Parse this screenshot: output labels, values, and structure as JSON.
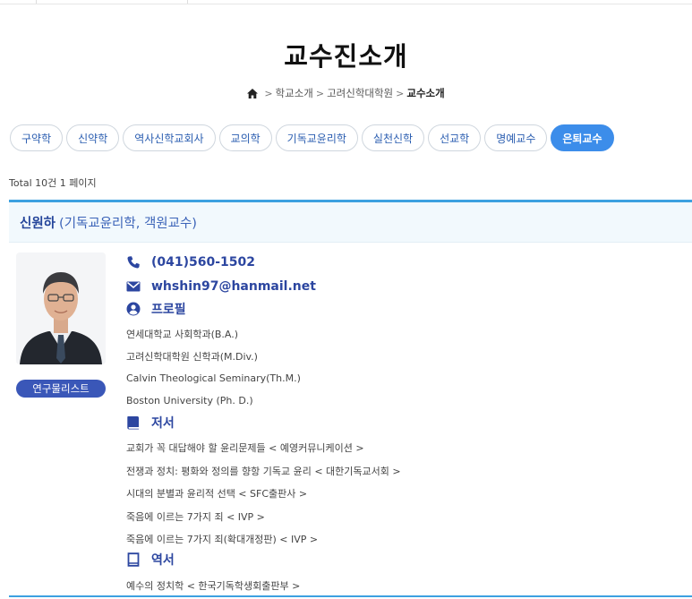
{
  "page": {
    "title": "교수진소개"
  },
  "breadcrumb": {
    "items": [
      "학교소개",
      "고려신학대학원"
    ],
    "current": "교수소개"
  },
  "tabs": [
    {
      "label": "구약학",
      "active": false
    },
    {
      "label": "신약학",
      "active": false
    },
    {
      "label": "역사신학교회사",
      "active": false
    },
    {
      "label": "교의학",
      "active": false
    },
    {
      "label": "기독교윤리학",
      "active": false
    },
    {
      "label": "실천신학",
      "active": false
    },
    {
      "label": "선교학",
      "active": false
    },
    {
      "label": "명예교수",
      "active": false
    },
    {
      "label": "은퇴교수",
      "active": true
    }
  ],
  "total_text": "Total 10건 1 페이지",
  "professor": {
    "name": "신원하",
    "role": "(기독교윤리학, 객원교수)",
    "research_button": "연구물리스트",
    "phone": "(041)560-1502",
    "email": "whshin97@hanmail.net",
    "profile_heading": "프로필",
    "profile": [
      "연세대학교 사회학과(B.A.)",
      "고려신학대학원 신학과(M.Div.)",
      "Calvin Theological Seminary(Th.M.)",
      "Boston University (Ph. D.)"
    ],
    "books_heading": "저서",
    "books": [
      "교회가 꼭 대답해야 할 윤리문제들 < 예영커뮤니케이션 >",
      "전쟁과 정치: 평화와 정의를 향항 기독교 윤리 < 대한기독교서회 >",
      "시대의 분별과 윤리적 선택 < SFC출판사 >",
      "죽음에 이르는 7가지 죄 < IVP >",
      "죽음에 이르는 7가지 죄(확대개정판) < IVP >"
    ],
    "translations_heading": "역서",
    "translations": [
      "예수의 정치학 < 한국기독학생회출판부 >"
    ]
  },
  "icons": {
    "home": "home-icon",
    "phone": "phone-icon",
    "email": "envelope-icon",
    "profile": "user-circle-icon",
    "books": "book-icon",
    "translations": "open-book-icon"
  },
  "colors": {
    "accent": "#3c8dea",
    "heading_blue": "#2c46a0",
    "card_border": "#3da1e0",
    "button": "#3a57b8"
  }
}
